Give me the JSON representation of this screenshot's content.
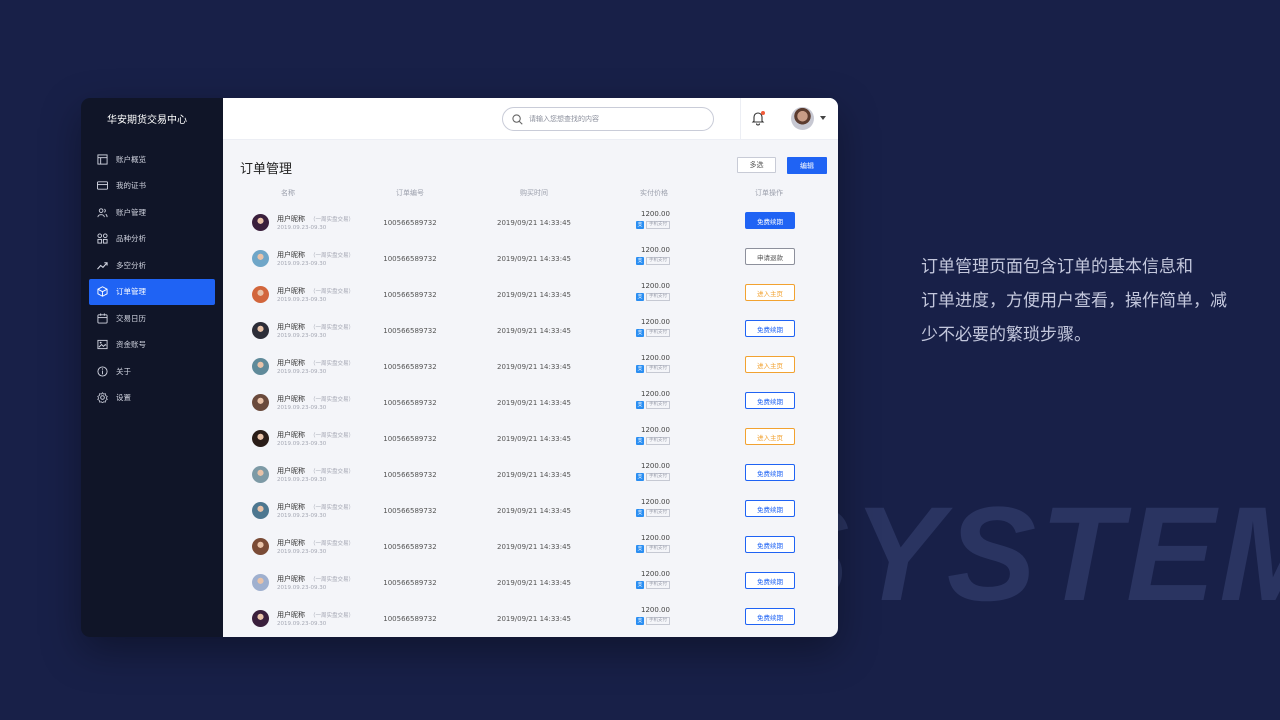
{
  "brand": "华安期货交易中心",
  "sidebar": {
    "items": [
      {
        "label": "账户概览",
        "icon": "dashboard-icon"
      },
      {
        "label": "我的证书",
        "icon": "card-icon"
      },
      {
        "label": "账户管理",
        "icon": "users-icon"
      },
      {
        "label": "品种分析",
        "icon": "grid-icon"
      },
      {
        "label": "多空分析",
        "icon": "trend-icon"
      },
      {
        "label": "订单管理",
        "icon": "cube-icon",
        "active": true
      },
      {
        "label": "交易日历",
        "icon": "calendar-icon"
      },
      {
        "label": "资金账号",
        "icon": "image-icon"
      },
      {
        "label": "关于",
        "icon": "info-icon"
      },
      {
        "label": "设置",
        "icon": "gear-icon"
      }
    ]
  },
  "search": {
    "placeholder": "请输入您想查找的内容"
  },
  "page_title": "订单管理",
  "buttons": {
    "multi": "多选",
    "edit": "编辑"
  },
  "columns": [
    "名称",
    "订单编号",
    "购买时间",
    "实付价格",
    "订单操作"
  ],
  "rows": [
    {
      "nickname": "用户昵称",
      "tag": "（一周实盘交易）",
      "range": "2019.09.23-09.30",
      "order_id": "100566589732",
      "time": "2019/09/21 14:33:45",
      "price": "1200.00",
      "pay_icon": "支",
      "pay_tag": "手机支付",
      "action": "免费续期",
      "action_style": "primary",
      "avatar_color": "#3a1f3c"
    },
    {
      "nickname": "用户昵称",
      "tag": "（一周实盘交易）",
      "range": "2019.09.23-09.30",
      "order_id": "100566589732",
      "time": "2019/09/21 14:33:45",
      "price": "1200.00",
      "pay_icon": "支",
      "pay_tag": "手机支付",
      "action": "申请退款",
      "action_style": "outline-gray",
      "avatar_color": "#6fa6c8"
    },
    {
      "nickname": "用户昵称",
      "tag": "（一周实盘交易）",
      "range": "2019.09.23-09.30",
      "order_id": "100566589732",
      "time": "2019/09/21 14:33:45",
      "price": "1200.00",
      "pay_icon": "支",
      "pay_tag": "手机支付",
      "action": "进入主页",
      "action_style": "outline-orange",
      "avatar_color": "#d2663c"
    },
    {
      "nickname": "用户昵称",
      "tag": "（一周实盘交易）",
      "range": "2019.09.23-09.30",
      "order_id": "100566589732",
      "time": "2019/09/21 14:33:45",
      "price": "1200.00",
      "pay_icon": "支",
      "pay_tag": "手机支付",
      "action": "免费续期",
      "action_style": "outline-blue",
      "avatar_color": "#2c2d38"
    },
    {
      "nickname": "用户昵称",
      "tag": "（一周实盘交易）",
      "range": "2019.09.23-09.30",
      "order_id": "100566589732",
      "time": "2019/09/21 14:33:45",
      "price": "1200.00",
      "pay_icon": "支",
      "pay_tag": "手机支付",
      "action": "进入主页",
      "action_style": "outline-orange",
      "avatar_color": "#5f8a9a"
    },
    {
      "nickname": "用户昵称",
      "tag": "（一周实盘交易）",
      "range": "2019.09.23-09.30",
      "order_id": "100566589732",
      "time": "2019/09/21 14:33:45",
      "price": "1200.00",
      "pay_icon": "支",
      "pay_tag": "手机支付",
      "action": "免费续期",
      "action_style": "outline-blue",
      "avatar_color": "#6a4a3c"
    },
    {
      "nickname": "用户昵称",
      "tag": "（一周实盘交易）",
      "range": "2019.09.23-09.30",
      "order_id": "100566589732",
      "time": "2019/09/21 14:33:45",
      "price": "1200.00",
      "pay_icon": "支",
      "pay_tag": "手机支付",
      "action": "进入主页",
      "action_style": "outline-orange",
      "avatar_color": "#2a1d18"
    },
    {
      "nickname": "用户昵称",
      "tag": "（一周实盘交易）",
      "range": "2019.09.23-09.30",
      "order_id": "100566589732",
      "time": "2019/09/21 14:33:45",
      "price": "1200.00",
      "pay_icon": "支",
      "pay_tag": "手机支付",
      "action": "免费续期",
      "action_style": "outline-blue",
      "avatar_color": "#7d9aa6"
    },
    {
      "nickname": "用户昵称",
      "tag": "（一周实盘交易）",
      "range": "2019.09.23-09.30",
      "order_id": "100566589732",
      "time": "2019/09/21 14:33:45",
      "price": "1200.00",
      "pay_icon": "支",
      "pay_tag": "手机支付",
      "action": "免费续期",
      "action_style": "outline-blue",
      "avatar_color": "#4d7790"
    },
    {
      "nickname": "用户昵称",
      "tag": "（一周实盘交易）",
      "range": "2019.09.23-09.30",
      "order_id": "100566589732",
      "time": "2019/09/21 14:33:45",
      "price": "1200.00",
      "pay_icon": "支",
      "pay_tag": "手机支付",
      "action": "免费续期",
      "action_style": "outline-blue",
      "avatar_color": "#7a4b36"
    },
    {
      "nickname": "用户昵称",
      "tag": "（一周实盘交易）",
      "range": "2019.09.23-09.30",
      "order_id": "100566589732",
      "time": "2019/09/21 14:33:45",
      "price": "1200.00",
      "pay_icon": "支",
      "pay_tag": "手机支付",
      "action": "免费续期",
      "action_style": "outline-blue",
      "avatar_color": "#9fb0cf"
    },
    {
      "nickname": "用户昵称",
      "tag": "（一周实盘交易）",
      "range": "2019.09.23-09.30",
      "order_id": "100566589732",
      "time": "2019/09/21 14:33:45",
      "price": "1200.00",
      "pay_icon": "支",
      "pay_tag": "手机支付",
      "action": "免费续期",
      "action_style": "outline-blue",
      "avatar_color": "#3a1f3c"
    }
  ],
  "description": [
    "订单管理页面包含订单的基本信息和",
    "订单进度，方便用户查看，操作简单，减",
    "少不必要的繁琐步骤。"
  ],
  "background_word": "SYSTEM",
  "colors": {
    "background": "#182048",
    "sidebar": "#101528",
    "accent": "#1f63f4",
    "warning": "#f2a230"
  }
}
